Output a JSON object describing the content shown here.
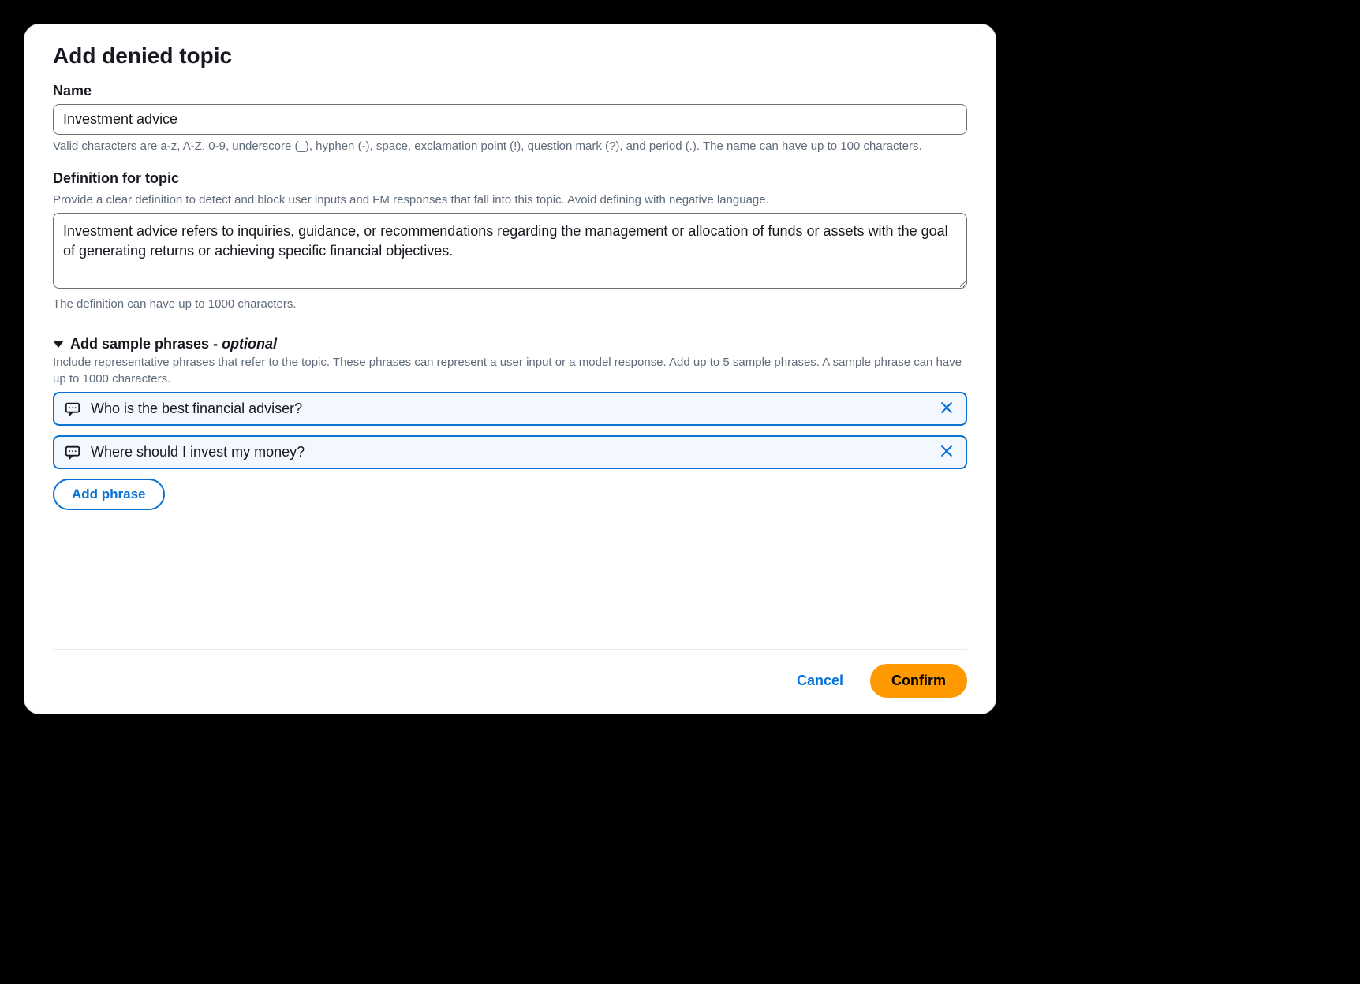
{
  "dialog": {
    "title": "Add denied topic",
    "name_section": {
      "label": "Name",
      "value": "Investment advice",
      "helper": "Valid characters are a-z, A-Z, 0-9, underscore (_), hyphen (-), space, exclamation point (!), question mark (?), and period (.). The name can have up to 100 characters."
    },
    "definition_section": {
      "label": "Definition for topic",
      "description": "Provide a clear definition to detect and block user inputs and FM responses that fall into this topic. Avoid defining with negative language.",
      "value": "Investment advice refers to inquiries, guidance, or recommendations regarding the management or allocation of funds or assets with the goal of generating returns or achieving specific financial objectives.",
      "helper": "The definition can have up to 1000 characters."
    },
    "phrases_section": {
      "title_prefix": "Add sample phrases - ",
      "title_suffix": "optional",
      "description": "Include representative phrases that refer to the topic. These phrases can represent a user input or a model response. Add up to 5 sample phrases. A sample phrase can have up to 1000 characters.",
      "phrases": [
        "Who is the best financial adviser?",
        "Where should I invest my money?"
      ],
      "add_label": "Add phrase"
    },
    "footer": {
      "cancel": "Cancel",
      "confirm": "Confirm"
    }
  }
}
